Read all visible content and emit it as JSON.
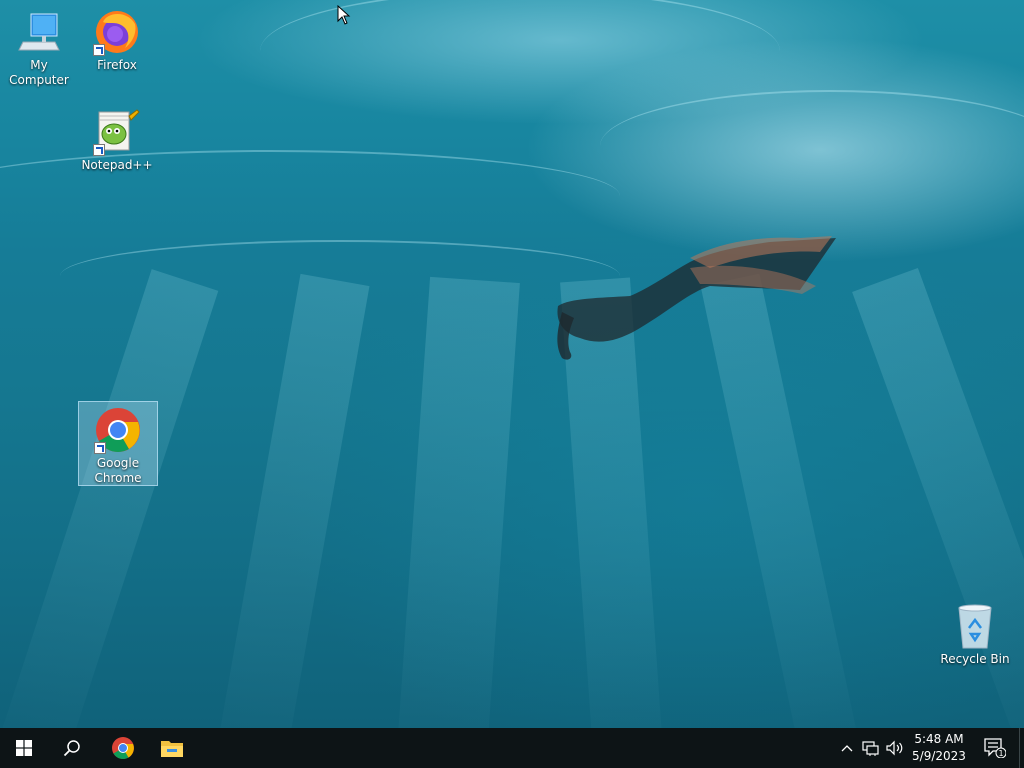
{
  "desktop": {
    "icons": [
      {
        "label": "My Computer",
        "icon": "monitor-icon"
      },
      {
        "label": "Firefox",
        "icon": "firefox-icon"
      },
      {
        "label": "Notepad++",
        "icon": "notepadpp-icon"
      },
      {
        "label_line1": "Google",
        "label_line2": "Chrome",
        "icon": "chrome-icon",
        "selected": true
      },
      {
        "label": "Recycle Bin",
        "icon": "recycle-bin-icon"
      }
    ]
  },
  "taskbar": {
    "start_icon": "windows-logo-icon",
    "search_icon": "search-icon",
    "pinned": [
      "chrome-icon",
      "file-explorer-icon"
    ],
    "tray": {
      "overflow_icon": "chevron-up-icon",
      "network_icon": "network-icon",
      "volume_icon": "volume-icon",
      "time": "5:48 AM",
      "date": "5/9/2023",
      "notification_count": "1"
    }
  },
  "colors": {
    "taskbar_bg": "#0d1416",
    "wallpaper_primary": "#167c97",
    "selection": "#b4dcf0"
  }
}
